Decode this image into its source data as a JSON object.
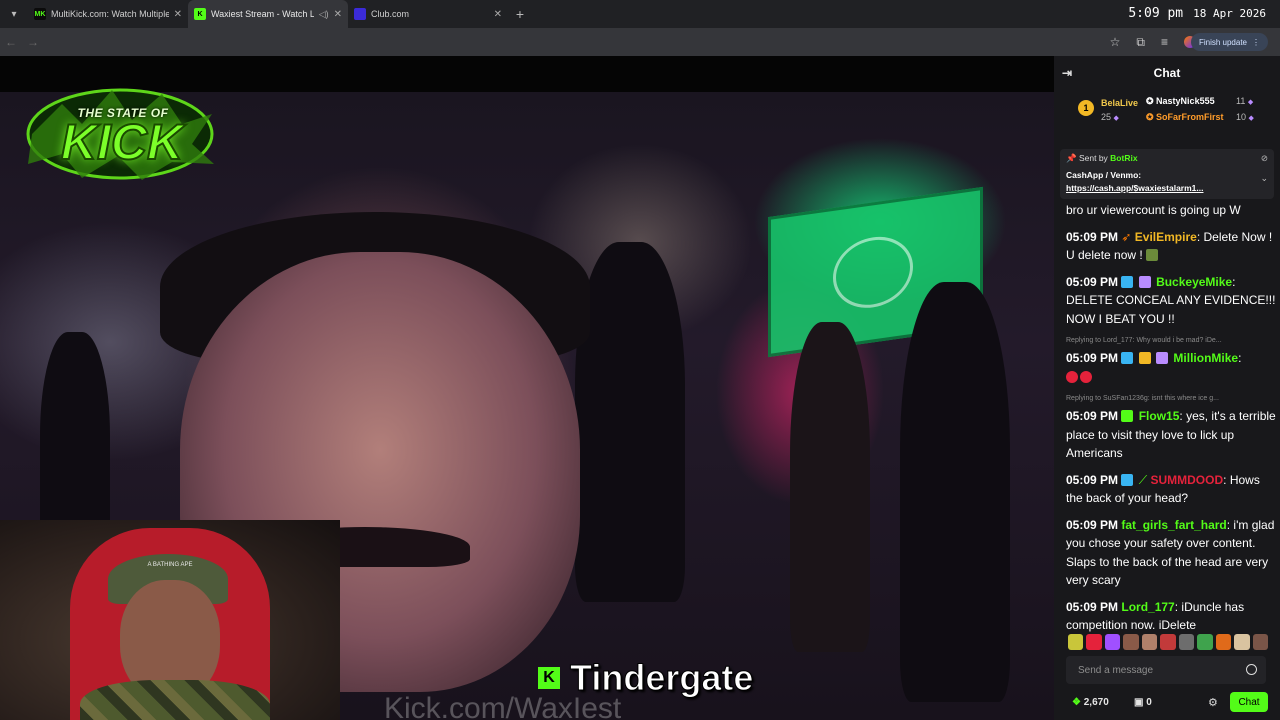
{
  "tabs": [
    {
      "title": "MultiKick.com: Watch Multiple",
      "favicon": "MK",
      "color": "#53fc18"
    },
    {
      "title": "Waxiest Stream - Watch Live",
      "favicon": "K",
      "color": "#53fc18"
    },
    {
      "title": "Club.com",
      "favicon": "",
      "color": "#3b2bd9"
    }
  ],
  "clock": {
    "time": "5:09 pm",
    "date": "18 Apr 2026"
  },
  "toolbar": {
    "finish_update": "Finish update"
  },
  "stream": {
    "overlay_logo_top": "THE STATE OF",
    "overlay_logo_main": "KICK",
    "watermark": "Kick.com/WaxIest",
    "webcam_cap_text": "A BATHING APE",
    "caption_badge": "K",
    "caption": "Tindergate"
  },
  "chat": {
    "title": "Chat",
    "leaderboard": {
      "rank": "1",
      "first": {
        "name": "BelaLive",
        "count": "25"
      },
      "second": {
        "name": "NastyNick555",
        "count": "11"
      },
      "third": {
        "name": "SoFarFromFirst",
        "count": "10"
      }
    },
    "pinned": {
      "sent_by": "Sent by",
      "bot": "BotRix",
      "line1": "CashApp / Venmo:",
      "link": "https://cash.app/$waxiestalarm1..."
    },
    "messages": [
      {
        "time": "",
        "user": "",
        "color": "#fff",
        "text": "bro ur viewercount is going up W",
        "reply": ""
      },
      {
        "time": "05:09 PM",
        "user": "EvilEmpire",
        "color": "#f2b825",
        "text": "Delete Now ! U delete now !",
        "reply": ""
      },
      {
        "time": "05:09 PM",
        "user": "BuckeyeMike",
        "color": "#53fc18",
        "text": "DELETE CONCEAL ANY EVIDENCE!!! NOW I BEAT YOU !!",
        "reply": ""
      },
      {
        "time": "05:09 PM",
        "user": "MillionMike",
        "color": "#53fc18",
        "text": "",
        "reply": "Replying to Lord_177: Why would i be mad? iDe..."
      },
      {
        "time": "05:09 PM",
        "user": "Flow15",
        "color": "#53fc18",
        "text": "yes, it's a terrible place to visit they love to lick up Americans",
        "reply": "Replying to SuSFan1236g: isnt this where ice g..."
      },
      {
        "time": "05:09 PM",
        "user": "SUMMDOOD",
        "color": "#e5223b",
        "text": "Hows the back of your head?",
        "reply": ""
      },
      {
        "time": "05:09 PM",
        "user": "fat_girls_fart_hard",
        "color": "#53fc18",
        "text": "i'm glad you chose your safety over content. Slaps to the back of the head are very very scary",
        "reply": ""
      },
      {
        "time": "05:09 PM",
        "user": "Lord_177",
        "color": "#53fc18",
        "text": "iDuncle has competition now. iDelete",
        "reply": ""
      }
    ],
    "input_placeholder": "Send a message",
    "points": "2,670",
    "zero": "0",
    "chat_button": "Chat"
  },
  "colors": {
    "kick_green": "#53fc18",
    "chat_bg": "#18181b"
  }
}
